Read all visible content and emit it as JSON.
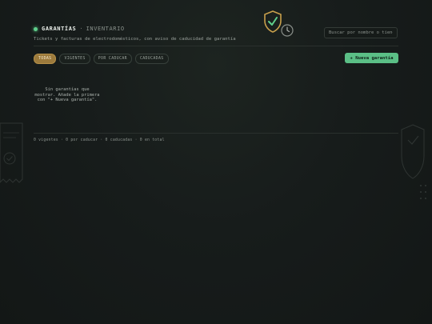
{
  "header": {
    "title": "GARANTÍAS",
    "separator": "·",
    "tag": "INVENTARIO",
    "subtitle": "Tickets y facturas de electrodomésticos, con aviso de caducidad de garantía"
  },
  "search": {
    "placeholder": "Buscar por nombre o tienda"
  },
  "filters": [
    {
      "label": "TODAS",
      "active": true
    },
    {
      "label": "VIGENTES",
      "active": false
    },
    {
      "label": "POR CADUCAR",
      "active": false
    },
    {
      "label": "CADUCADAS",
      "active": false
    }
  ],
  "actions": {
    "new_label": "+ Nueva garantía"
  },
  "empty_state": {
    "message": "Sin garantías que mostrar. Añade la primera con \"+ Nueva garantía\"."
  },
  "footer": {
    "summary": "0 vigentes · 0 por caducar · 0 caducadas · 0 en total"
  },
  "colors": {
    "accent": "#5bbf86",
    "active_chip": "#9c7a3c",
    "status_dot": "#5fcf8c"
  },
  "icons": [
    "shield-check-icon",
    "clock-icon",
    "receipt-icon"
  ]
}
